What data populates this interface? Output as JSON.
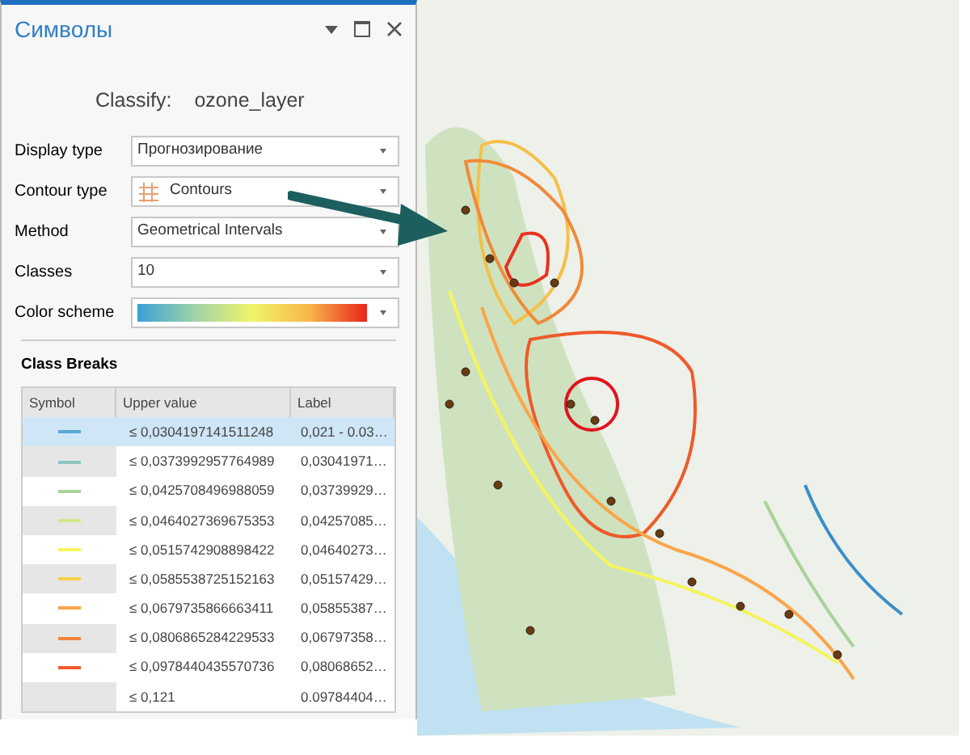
{
  "pane": {
    "title": "Символы"
  },
  "classify": {
    "label": "Classify:",
    "layer": "ozone_layer"
  },
  "fields": [
    {
      "label": "Display type",
      "kind": "text",
      "value": "Прогнозирование"
    },
    {
      "label": "Contour type",
      "kind": "icon-text",
      "value": "Contours"
    },
    {
      "label": "Method",
      "kind": "text",
      "value": "Geometrical Intervals"
    },
    {
      "label": "Classes",
      "kind": "text",
      "value": "10"
    },
    {
      "label": "Color scheme",
      "kind": "ramp"
    }
  ],
  "class_breaks": {
    "title": "Class Breaks",
    "columns": [
      "Symbol",
      "Upper value",
      "Label"
    ],
    "rows": [
      {
        "selected": true,
        "color": "#5aa9d6",
        "upper": "≤ 0,0304197141511248",
        "label": "0,021 - 0.03…"
      },
      {
        "selected": false,
        "color": "#8fc4c0",
        "upper": "≤ 0,0373992957764989",
        "label": "0,03041971…"
      },
      {
        "selected": false,
        "color": "#a9d39a",
        "upper": "≤ 0,0425708496988059",
        "label": "0,03739929…"
      },
      {
        "selected": false,
        "color": "#d3e88a",
        "upper": "≤ 0,0464027369675353",
        "label": "0,04257085…"
      },
      {
        "selected": false,
        "color": "#f3f55c",
        "upper": "≤ 0,0515742908898422",
        "label": "0,04640273…"
      },
      {
        "selected": false,
        "color": "#f7cf4f",
        "upper": "≤ 0,0585538725152163",
        "label": "0,05157429…"
      },
      {
        "selected": false,
        "color": "#f9a64a",
        "upper": "≤ 0,0679735866663411",
        "label": "0,05855387…"
      },
      {
        "selected": false,
        "color": "#f5803a",
        "upper": "≤ 0,0806865284229533",
        "label": "0,06797358…"
      },
      {
        "selected": false,
        "color": "#ef5a2a",
        "upper": "≤ 0,0978440435570736",
        "label": "0,08068652…"
      },
      {
        "selected": false,
        "upper": "≤ 0,121",
        "label": "0.09784404…"
      }
    ]
  }
}
